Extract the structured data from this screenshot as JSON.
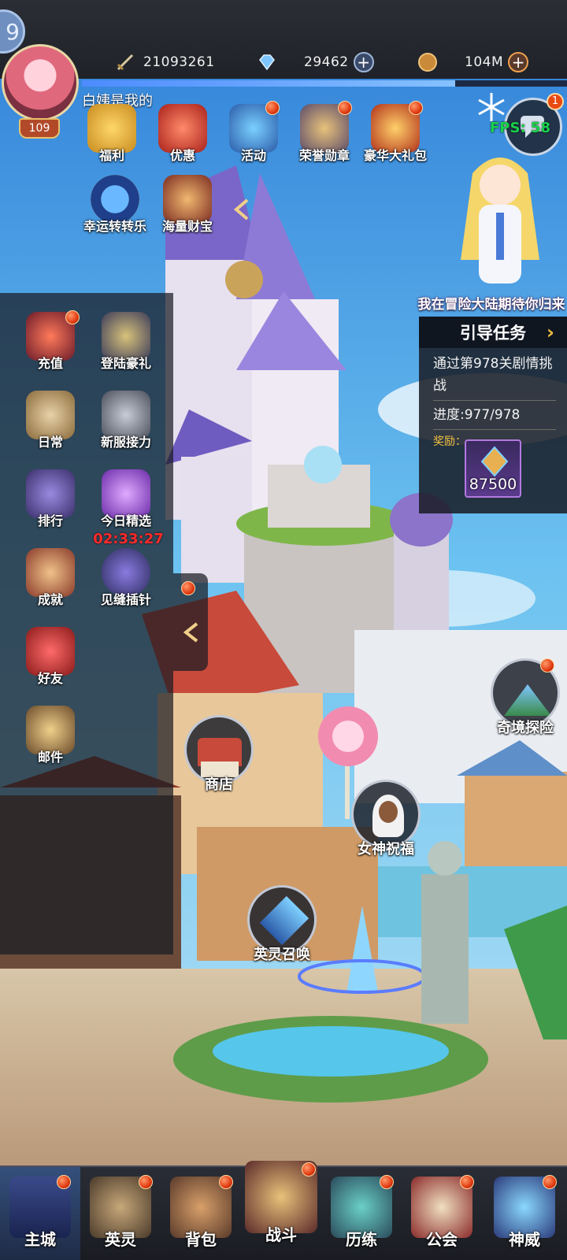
{
  "top": {
    "partial_badge_text": "9",
    "power": "21093261",
    "diamonds": "29462",
    "gold": "104M",
    "exp_fraction": 0.77
  },
  "player": {
    "name": "白姨是我的",
    "level": "109"
  },
  "top_features": [
    {
      "label": "福利",
      "icon": "gift-box-icon",
      "dot": false
    },
    {
      "label": "优惠",
      "icon": "coupon-scroll-icon",
      "dot": false
    },
    {
      "label": "活动",
      "icon": "event-horn-icon",
      "dot": true
    },
    {
      "label": "荣誉勋章",
      "icon": "honor-medal-icon",
      "dot": true
    },
    {
      "label": "豪华大礼包",
      "icon": "treasure-chest-icon",
      "dot": true
    }
  ],
  "second_features": [
    {
      "label": "幸运转转乐",
      "icon": "lucky-wheel-icon"
    },
    {
      "label": "海量财宝",
      "icon": "coin-bag-icon"
    }
  ],
  "chat": {
    "badge": "1",
    "fps": "FPS: 58"
  },
  "guide_caption": "我在冒险大陆期待你归来",
  "quest": {
    "title": "引导任务",
    "desc": "通过第978关剧情挑战",
    "progress": "进度:977/978",
    "reward_label": "奖励：",
    "reward_amount": "87500"
  },
  "side_menu": [
    {
      "label": "充值",
      "icon": "recharge-chest-icon",
      "dot": true
    },
    {
      "label": "登陆豪礼",
      "icon": "login-gift-icon",
      "dot": false
    },
    {
      "label": "日常",
      "icon": "daily-scroll-icon",
      "dot": false
    },
    {
      "label": "新服接力",
      "icon": "relay-gauntlet-icon",
      "dot": false
    },
    {
      "label": "排行",
      "icon": "ranking-crest-icon",
      "dot": false
    },
    {
      "label": "今日精选",
      "icon": "gem-icon",
      "dot": false
    },
    {
      "label": "成就",
      "icon": "achievement-cup-icon",
      "dot": false
    },
    {
      "label": "见缝插针",
      "icon": "pin-game-icon",
      "dot": false
    },
    {
      "label": "好友",
      "icon": "friends-icon",
      "dot": false
    },
    {
      "label": "邮件",
      "icon": "mail-icon",
      "dot": false
    }
  ],
  "today_timer": "02:33:27",
  "map": {
    "shop": "商店",
    "goddess": "女神祝福",
    "summon": "英灵召唤",
    "explore": "奇境探险"
  },
  "nav": [
    {
      "label": "主城",
      "icon": "castle-icon",
      "active": true
    },
    {
      "label": "英灵",
      "icon": "helmet-icon",
      "active": false
    },
    {
      "label": "背包",
      "icon": "backpack-icon",
      "active": false
    },
    {
      "label": "战斗",
      "icon": "battle-crest-icon",
      "active": false
    },
    {
      "label": "历练",
      "icon": "training-portal-icon",
      "active": false
    },
    {
      "label": "公会",
      "icon": "guild-banner-icon",
      "active": false
    },
    {
      "label": "神威",
      "icon": "crystal-icon",
      "active": false
    }
  ],
  "colors": {
    "sky": "#4aa6e6",
    "panel": "#191c23",
    "accent_gold": "#f0c040",
    "timer_red": "#ff2a2a",
    "fps_green": "#19d24a",
    "exp_blue": "#4d8bff"
  }
}
